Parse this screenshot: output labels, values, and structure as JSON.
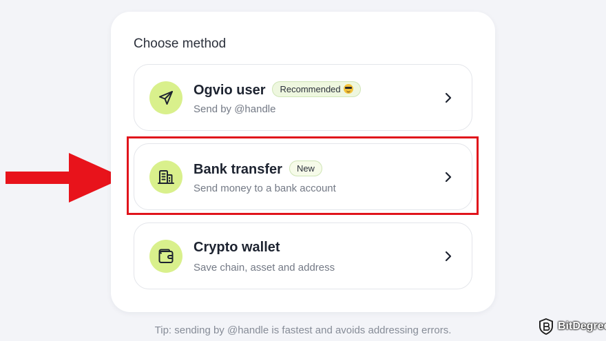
{
  "card": {
    "title": "Choose method"
  },
  "options": [
    {
      "title": "Ogvio user",
      "badge": "Recommended",
      "badge_emoji": "smiling-face-with-sunglasses",
      "subtitle": "Send by @handle",
      "icon": "send-plane-icon"
    },
    {
      "title": "Bank transfer",
      "badge": "New",
      "subtitle": "Send money to a bank account",
      "icon": "bank-building-icon"
    },
    {
      "title": "Crypto wallet",
      "subtitle": "Save chain, asset and address",
      "icon": "wallet-icon"
    }
  ],
  "tip": "Tip: sending by @handle is fastest and avoids addressing errors.",
  "brand": {
    "name": "BitDegree"
  },
  "colors": {
    "accent_green": "#d9f08c",
    "highlight_red": "#e0141b",
    "background": "#f3f4f8"
  }
}
